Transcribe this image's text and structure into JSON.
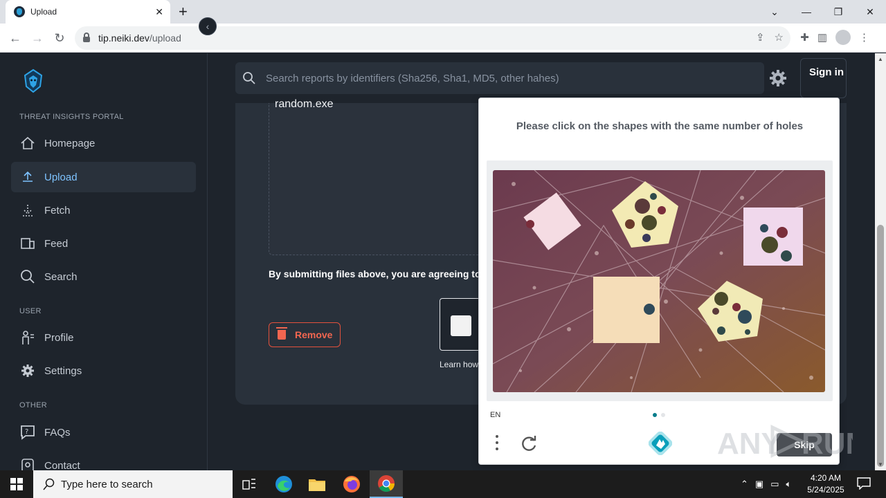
{
  "browser": {
    "tab_title": "Upload",
    "url_host": "tip.neiki.dev",
    "url_path": "/upload"
  },
  "sidebar": {
    "section_portal": "THREAT INSIGHTS PORTAL",
    "section_user": "USER",
    "section_other": "OTHER",
    "items": [
      {
        "label": "Homepage",
        "icon": "home-icon"
      },
      {
        "label": "Upload",
        "icon": "upload-icon",
        "active": true
      },
      {
        "label": "Fetch",
        "icon": "fetch-icon"
      },
      {
        "label": "Feed",
        "icon": "feed-icon"
      },
      {
        "label": "Search",
        "icon": "search-icon"
      },
      {
        "label": "Profile",
        "icon": "profile-icon"
      },
      {
        "label": "Settings",
        "icon": "gear-icon"
      },
      {
        "label": "FAQs",
        "icon": "faq-icon"
      },
      {
        "label": "Contact",
        "icon": "contact-icon"
      }
    ]
  },
  "header": {
    "search_placeholder": "Search reports by identifiers (Sha256, Sha1, MD5, other hahes)",
    "signin_label": "Sign in"
  },
  "upload": {
    "filename": "random.exe",
    "agree_text": "By submitting files above, you are agreeing to",
    "remove_label": "Remove",
    "learn_text": "Learn how"
  },
  "captcha": {
    "prompt": "Please click on the shapes with the same number of holes",
    "language": "EN",
    "skip_label": "Skip",
    "page": 1,
    "pages": 2
  },
  "taskbar": {
    "search_placeholder": "Type here to search",
    "time": "4:20 AM",
    "date": "5/24/2025"
  },
  "watermark": "ANY RUN",
  "colors": {
    "accent": "#7ec3ff",
    "danger": "#f26650",
    "captcha_teal": "#0a7d8c"
  }
}
